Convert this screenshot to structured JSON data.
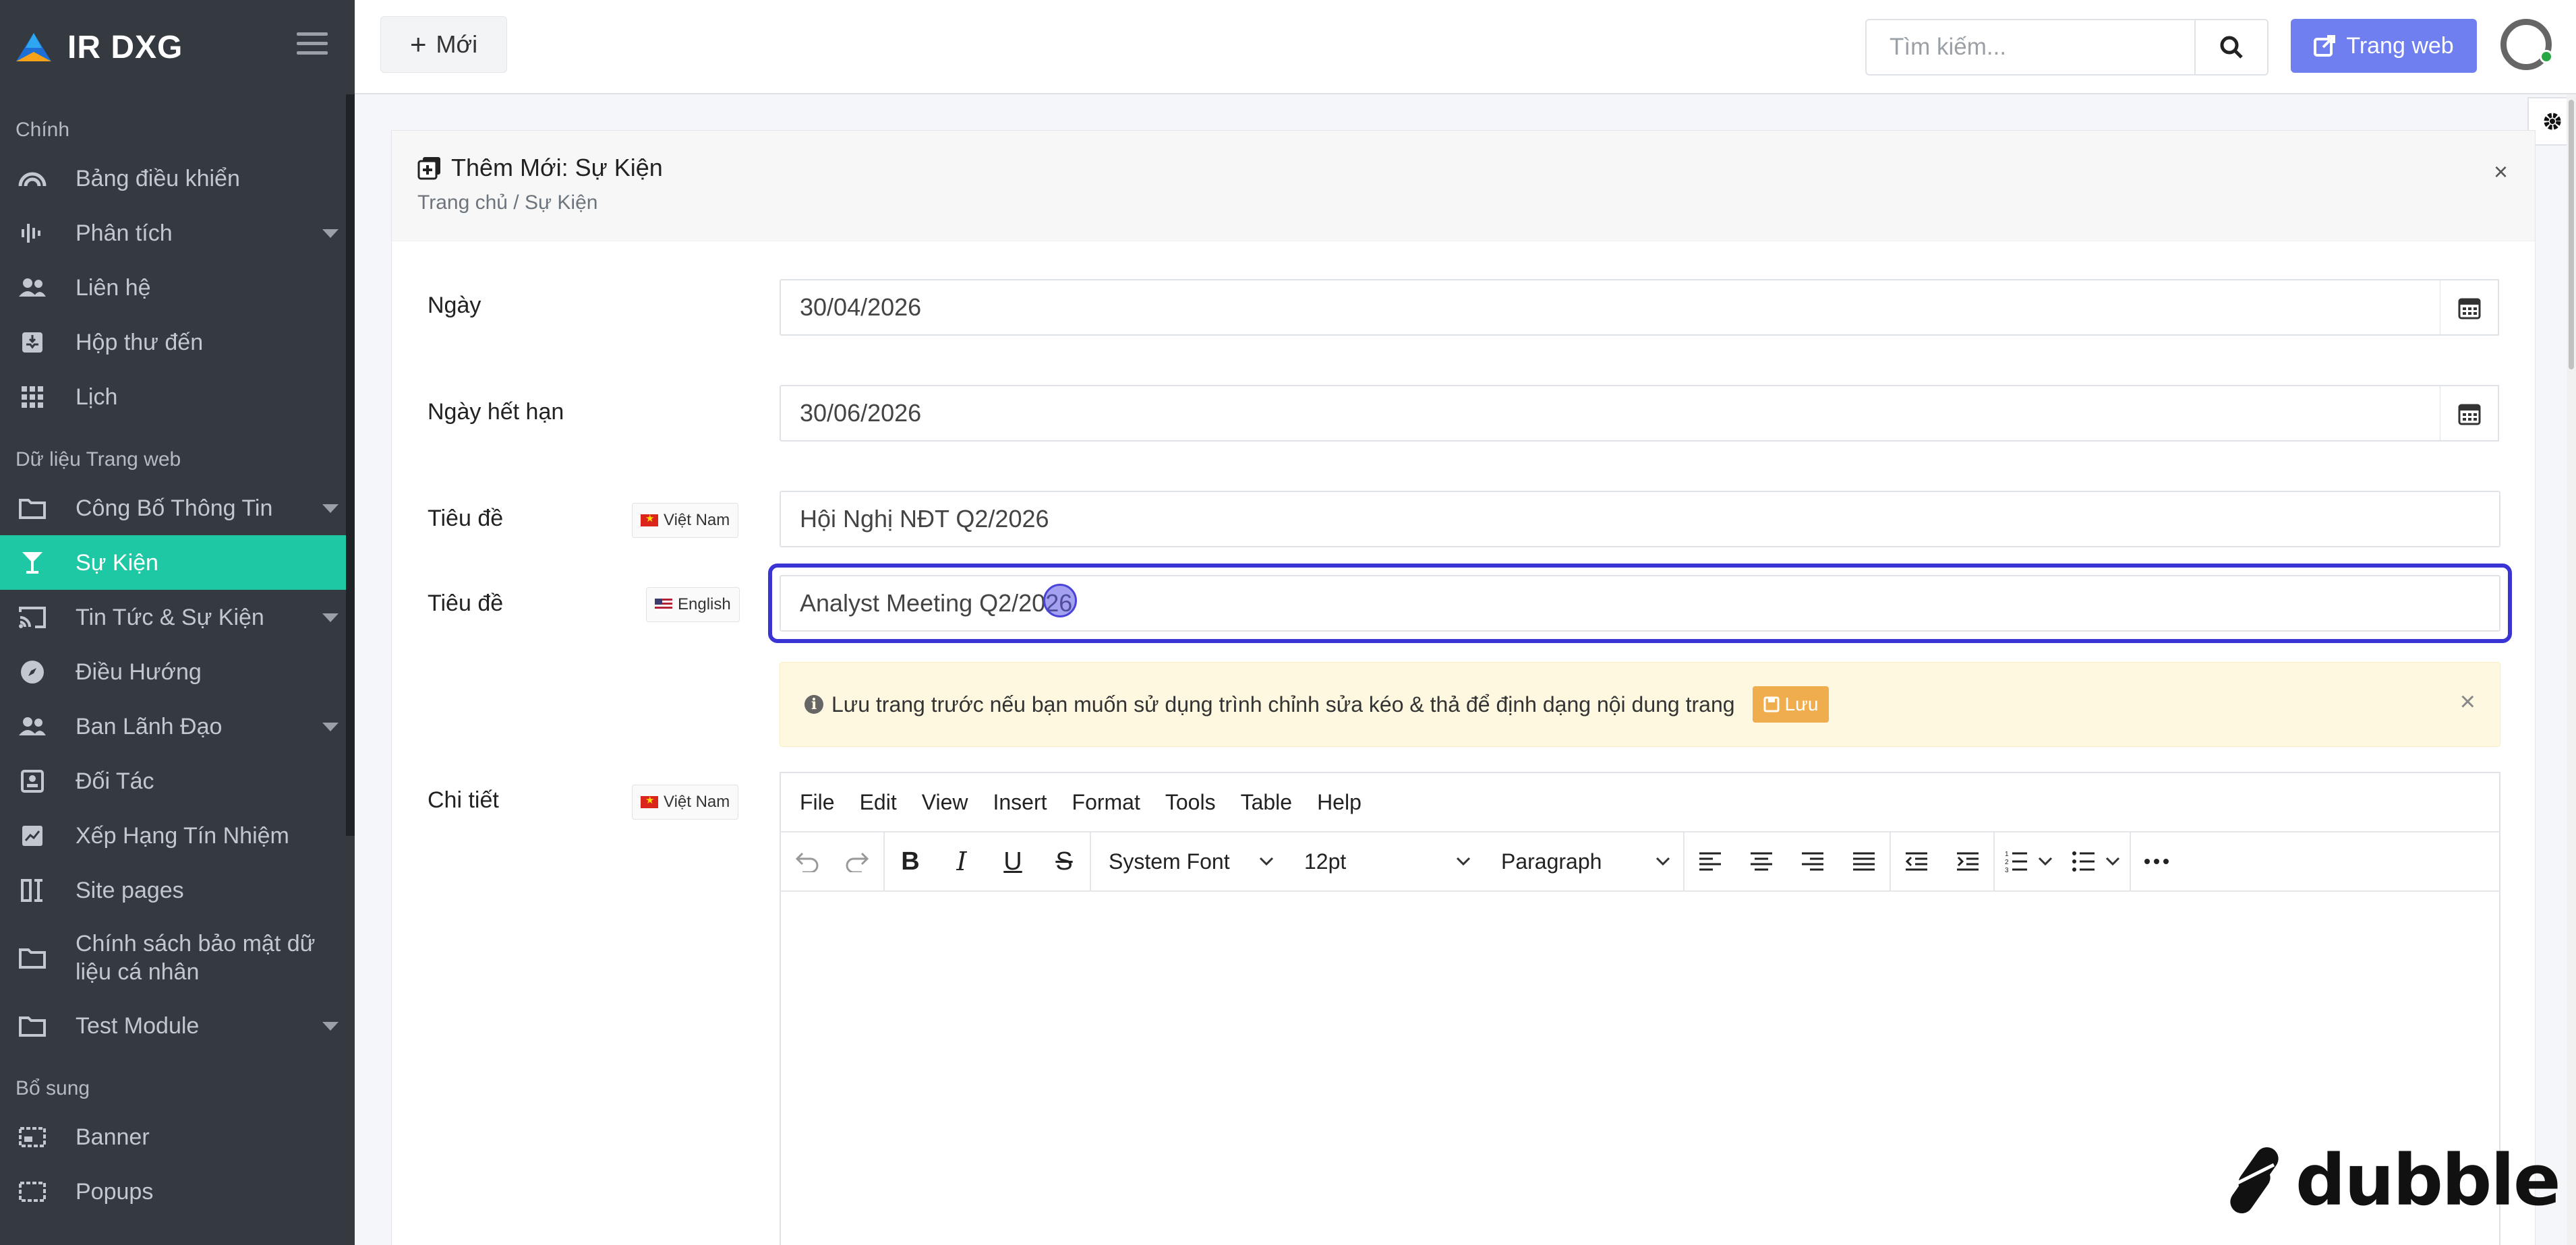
{
  "brand": {
    "name": "IR DXG"
  },
  "sidebar": {
    "sections": [
      {
        "header": "Chính",
        "items": [
          {
            "label": "Bảng điều khiển",
            "icon": "dashboard-gauge-icon",
            "caret": false
          },
          {
            "label": "Phân tích",
            "icon": "analytics-wave-icon",
            "caret": true
          },
          {
            "label": "Liên hệ",
            "icon": "contacts-users-icon",
            "caret": false
          },
          {
            "label": "Hộp thư đến",
            "icon": "inbox-icon",
            "caret": false
          },
          {
            "label": "Lịch",
            "icon": "calendar-grid-icon",
            "caret": false
          }
        ]
      },
      {
        "header": "Dữ liệu Trang web",
        "items": [
          {
            "label": "Công Bố Thông Tin",
            "icon": "folder-icon",
            "caret": true
          },
          {
            "label": "Sự Kiện",
            "icon": "glass-icon",
            "caret": false,
            "active": true
          },
          {
            "label": "Tin Tức & Sự Kiện",
            "icon": "cast-icon",
            "caret": true
          },
          {
            "label": "Điều Hướng",
            "icon": "compass-icon",
            "caret": false
          },
          {
            "label": "Ban Lãnh Đạo",
            "icon": "users-icon",
            "caret": true
          },
          {
            "label": "Đối Tác",
            "icon": "partner-card-icon",
            "caret": false
          },
          {
            "label": "Xếp Hạng Tín Nhiệm",
            "icon": "rating-chart-icon",
            "caret": false
          },
          {
            "label": "Site pages",
            "icon": "site-pages-icon",
            "caret": false
          },
          {
            "label": "Chính sách bảo mật dữ liệu cá nhân",
            "icon": "folder-icon",
            "caret": false
          },
          {
            "label": "Test Module",
            "icon": "folder-icon",
            "caret": true
          }
        ]
      },
      {
        "header": "Bổ sung",
        "items": [
          {
            "label": "Banner",
            "icon": "banner-icon",
            "caret": false
          },
          {
            "label": "Popups",
            "icon": "popup-icon",
            "caret": false
          }
        ]
      }
    ]
  },
  "topbar": {
    "new_label": "Mới",
    "search_placeholder": "Tìm kiếm...",
    "website_label": "Trang web"
  },
  "card": {
    "title": "Thêm Mới: Sự Kiện",
    "breadcrumb": "Trang chủ / Sự Kiện",
    "close": "×"
  },
  "form": {
    "date_label": "Ngày",
    "date_value": "30/04/2026",
    "expiry_label": "Ngày hết hạn",
    "expiry_value": "30/06/2026",
    "title_label": "Tiêu đề",
    "title_vi_value": "Hội Nghị NĐT Q2/2026",
    "title_en_label": "Tiêu đề",
    "title_en_value": "Analyst Meeting Q2/2026",
    "lang_vi": "Việt Nam",
    "lang_en": "English",
    "detail_label": "Chi tiết"
  },
  "alert": {
    "message": "Lưu trang trước nếu bạn muốn sử dụng trình chỉnh sửa kéo & thả để định dạng nội dung trang",
    "save_label": "Lưu",
    "close": "×"
  },
  "editor": {
    "menu": [
      "File",
      "Edit",
      "View",
      "Insert",
      "Format",
      "Tools",
      "Table",
      "Help"
    ],
    "font": "System Font",
    "size": "12pt",
    "block": "Paragraph"
  },
  "watermark": {
    "text": "dubble"
  }
}
